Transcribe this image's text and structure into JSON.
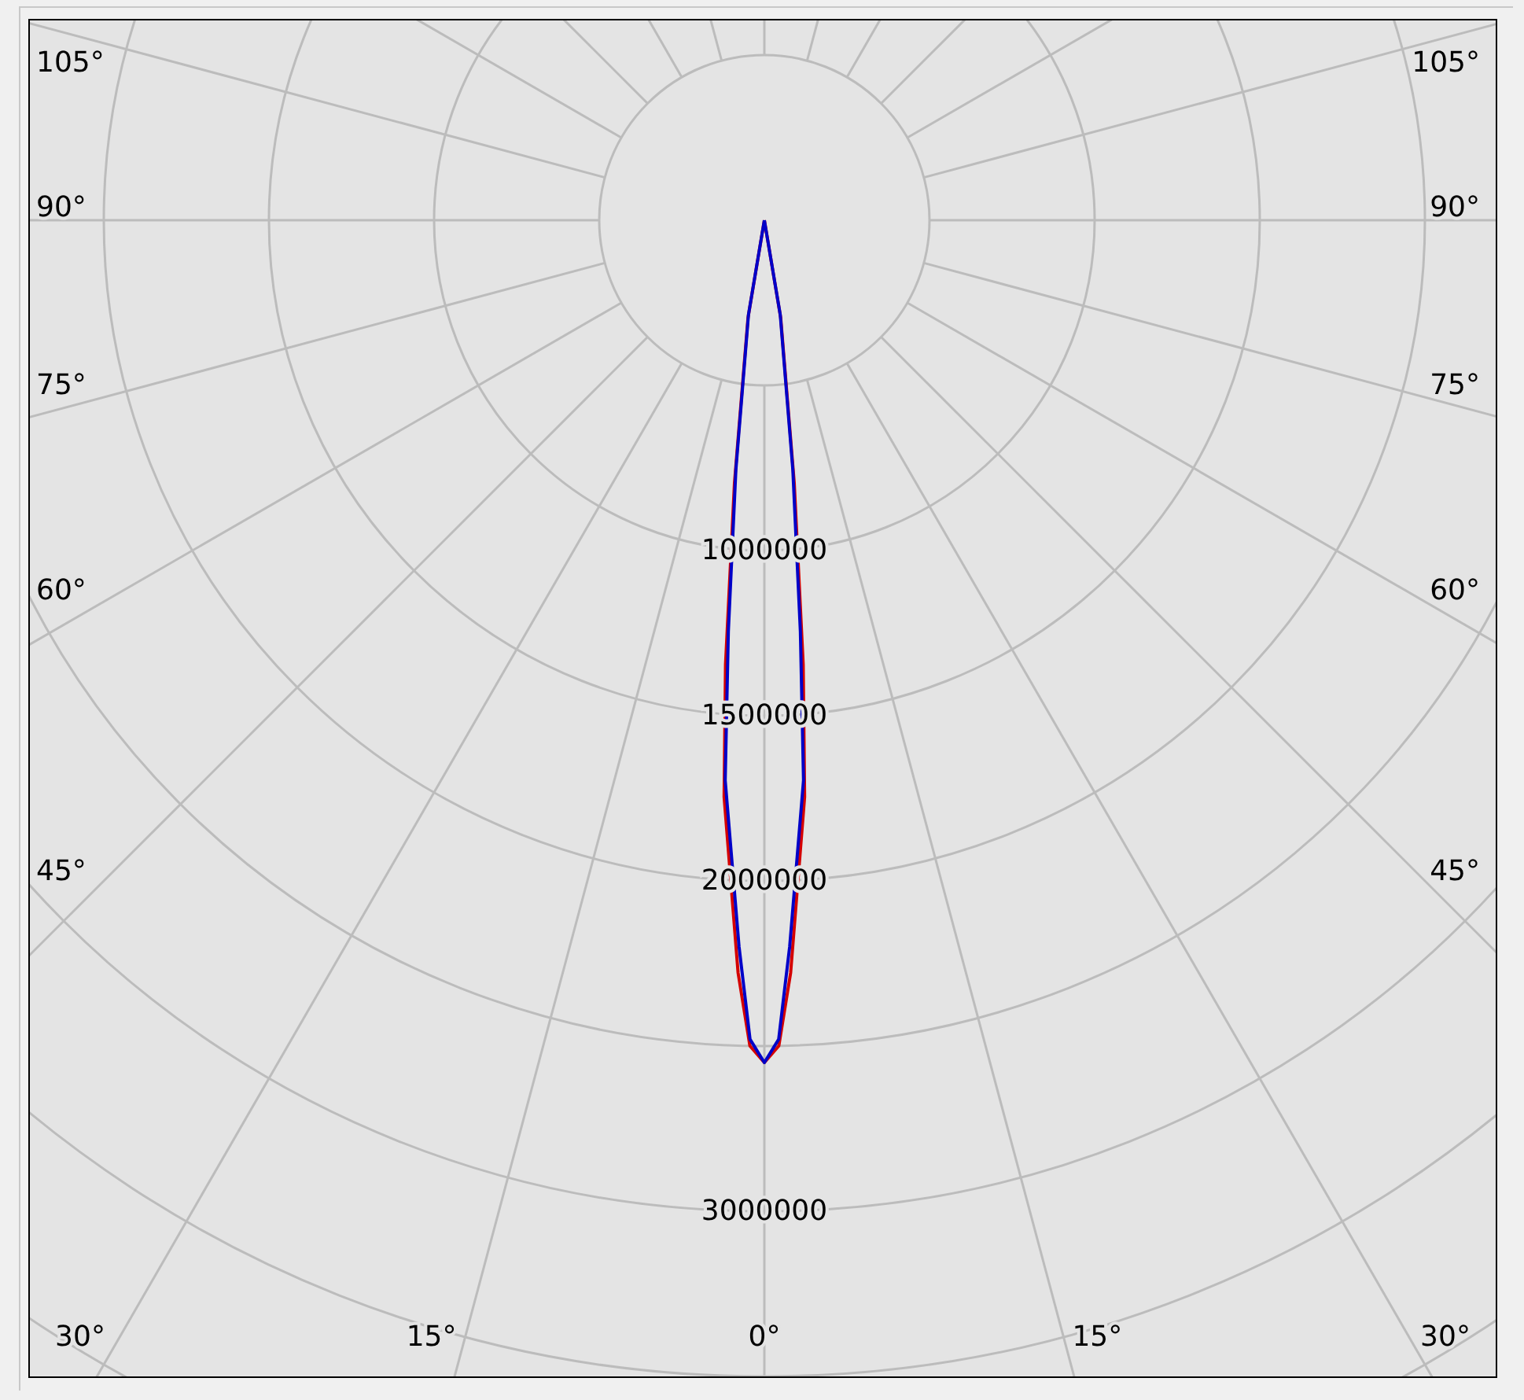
{
  "polar_chart": {
    "angle_labels_left": [
      "105°",
      "90°",
      "75°",
      "60°",
      "45°"
    ],
    "angle_labels_bottom": [
      "30°",
      "15°",
      "0°",
      "15°",
      "30°"
    ],
    "angle_labels_right": [
      "105°",
      "90°",
      "75°",
      "60°",
      "45°"
    ],
    "ring_labels": [
      "1000000",
      "1500000",
      "2000000",
      "3000000"
    ],
    "curves": [
      {
        "color": "#d40000"
      },
      {
        "color": "#0000c8"
      }
    ]
  }
}
